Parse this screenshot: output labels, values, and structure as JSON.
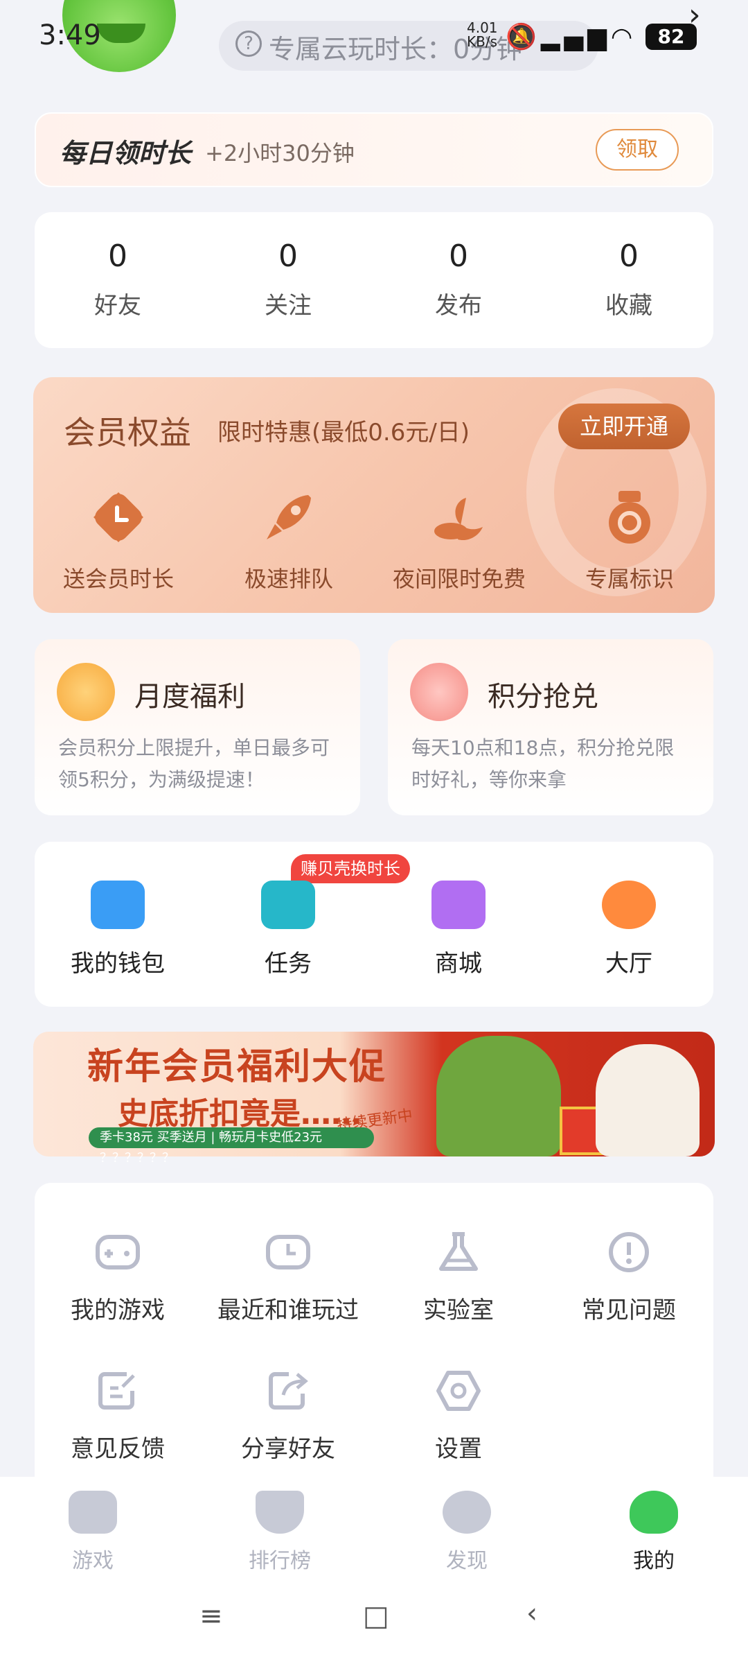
{
  "status_bar": {
    "time": "3:49",
    "net_speed_top": "4.01",
    "net_speed_bottom": "KB/s",
    "battery": "82"
  },
  "header": {
    "cloud_time_label": "专属云玩时长：0分钟"
  },
  "daily": {
    "title": "每日领时长",
    "subtitle": "+2小时30分钟",
    "button": "领取"
  },
  "stats": [
    {
      "value": "0",
      "label": "好友"
    },
    {
      "value": "0",
      "label": "关注"
    },
    {
      "value": "0",
      "label": "发布"
    },
    {
      "value": "0",
      "label": "收藏"
    }
  ],
  "vip": {
    "title": "会员权益",
    "subtitle": "限时特惠(最低0.6元/日)",
    "button": "立即开通",
    "items": [
      {
        "label": "送会员时长",
        "icon": "clock-icon"
      },
      {
        "label": "极速排队",
        "icon": "rocket-icon"
      },
      {
        "label": "夜间限时免费",
        "icon": "moon-cloud-icon"
      },
      {
        "label": "专属标识",
        "icon": "medal-icon"
      }
    ],
    "color": "#f6c4aa"
  },
  "cards": [
    {
      "title": "月度福利",
      "desc": "会员积分上限提升，单日最多可领5积分，为满级提速！"
    },
    {
      "title": "积分抢兑",
      "desc": "每天10点和18点，积分抢兑限时好礼，等你来拿"
    }
  ],
  "quick": {
    "badge": "赚贝壳换时长",
    "items": [
      {
        "label": "我的钱包",
        "icon": "wallet-icon",
        "color": "#3a9df5"
      },
      {
        "label": "任务",
        "icon": "task-icon",
        "color": "#26b7c9"
      },
      {
        "label": "商城",
        "icon": "shop-icon",
        "color": "#b16ef2"
      },
      {
        "label": "大厅",
        "icon": "chat-bubble-icon",
        "color": "#ff8a3d"
      }
    ]
  },
  "banner": {
    "title": "新年会员福利大促",
    "subtitle": "史底折扣竟是……",
    "tag": "持续更新中",
    "strip": "季卡38元 买季送月 | 畅玩月卡史低23元 ？？？？？？"
  },
  "tools": [
    {
      "label": "我的游戏",
      "icon": "gamepad-icon"
    },
    {
      "label": "最近和谁玩过",
      "icon": "history-gamepad-icon"
    },
    {
      "label": "实验室",
      "icon": "flask-icon"
    },
    {
      "label": "常见问题",
      "icon": "exclamation-circle-icon"
    },
    {
      "label": "意见反馈",
      "icon": "feedback-edit-icon"
    },
    {
      "label": "分享好友",
      "icon": "share-icon"
    },
    {
      "label": "设置",
      "icon": "settings-hexagon-icon"
    }
  ],
  "nav": [
    {
      "label": "游戏",
      "icon": "game-controller-icon"
    },
    {
      "label": "排行榜",
      "icon": "ranking-shield-icon"
    },
    {
      "label": "发现",
      "icon": "discover-eye-icon"
    },
    {
      "label": "我的",
      "icon": "mascot-icon"
    }
  ]
}
